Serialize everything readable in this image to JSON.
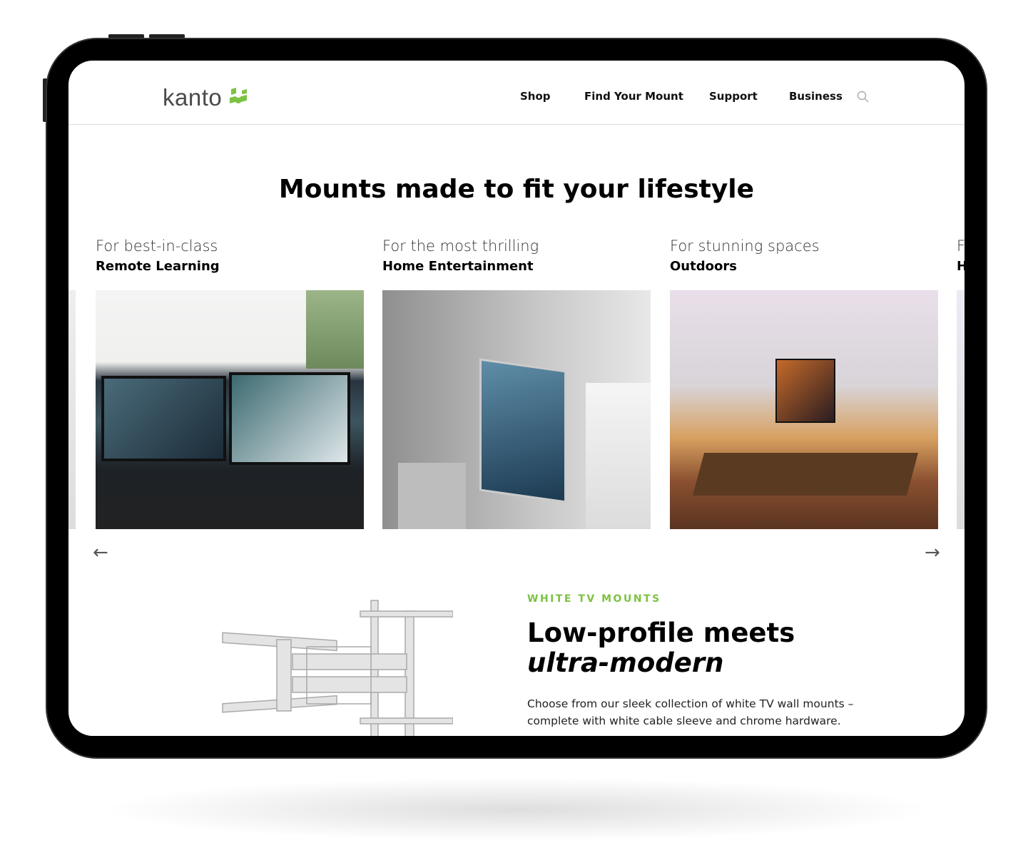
{
  "brand": {
    "logo_text": "kanto",
    "accent": "#7dc242"
  },
  "nav": {
    "items": [
      "Shop",
      "Find Your Mount",
      "Support",
      "Business"
    ],
    "search_icon": "search-icon"
  },
  "hero": {
    "title": "Mounts made to fit your lifestyle"
  },
  "carousel": {
    "cards": [
      {
        "subtitle": "For best-in-class",
        "category": "Remote Learning"
      },
      {
        "subtitle": "For the most thrilling",
        "category": "Home Entertainment"
      },
      {
        "subtitle": "For stunning spaces",
        "category": "Outdoors"
      },
      {
        "subtitle": "F",
        "category": "H"
      }
    ],
    "prev_icon": "arrow-left-icon",
    "next_icon": "arrow-right-icon"
  },
  "feature": {
    "eyebrow": "WHITE TV MOUNTS",
    "title_line1": "Low-profile meets",
    "title_line2": "ultra-modern",
    "body": "Choose from our sleek collection of white TV wall mounts – complete with white cable sleeve and chrome hardware."
  }
}
